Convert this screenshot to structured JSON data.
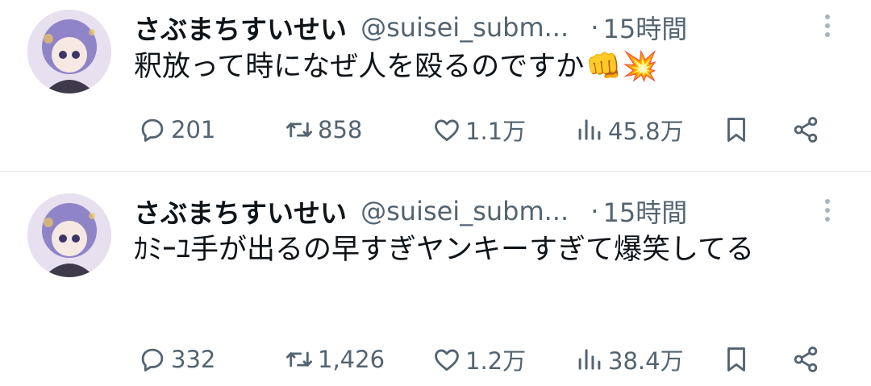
{
  "tweets": [
    {
      "display_name": "さぶまちすいせい",
      "handle": "@suisei_subm...",
      "separator": "·",
      "time": "15時間",
      "text": "釈放って時になぜ人を殴るのですか",
      "emojis": "👊💥",
      "replies": "201",
      "retweets": "858",
      "likes": "1.1万",
      "views": "45.8万"
    },
    {
      "display_name": "さぶまちすいせい",
      "handle": "@suisei_subm...",
      "separator": "·",
      "time": "15時間",
      "text": "ｶﾐｰﾕ手が出るの早すぎヤンキーすぎて爆笑してる",
      "emojis": "",
      "replies": "332",
      "retweets": "1,426",
      "likes": "1.2万",
      "views": "38.4万"
    }
  ],
  "colors": {
    "text": "#0f1419",
    "muted": "#536471",
    "divider": "#e5e7ea",
    "avatar_hair": "#9b8fd0"
  },
  "icons": [
    "reply-icon",
    "retweet-icon",
    "like-icon",
    "views-icon",
    "bookmark-icon",
    "share-icon",
    "more-icon",
    "avatar"
  ]
}
